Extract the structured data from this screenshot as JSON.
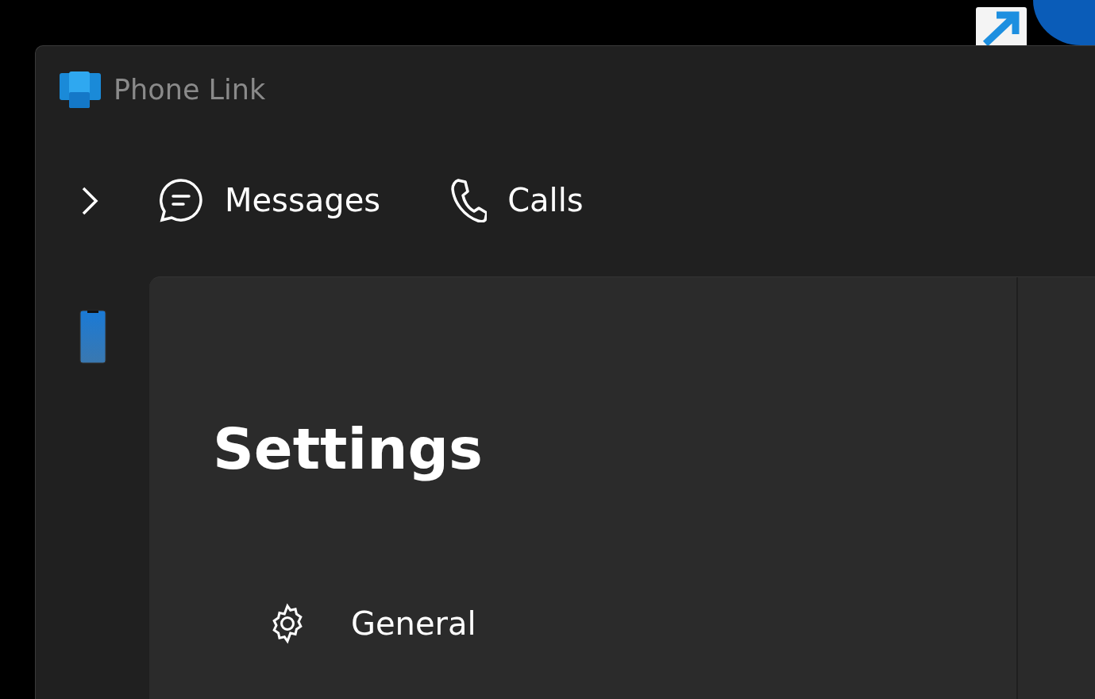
{
  "window": {
    "title": "Phone Link"
  },
  "tabs": [
    {
      "label": "Messages",
      "selected": false
    },
    {
      "label": "Calls",
      "selected": false
    }
  ],
  "page": {
    "title": "Settings"
  },
  "settings_items": [
    {
      "label": "General",
      "selected": false
    }
  ]
}
